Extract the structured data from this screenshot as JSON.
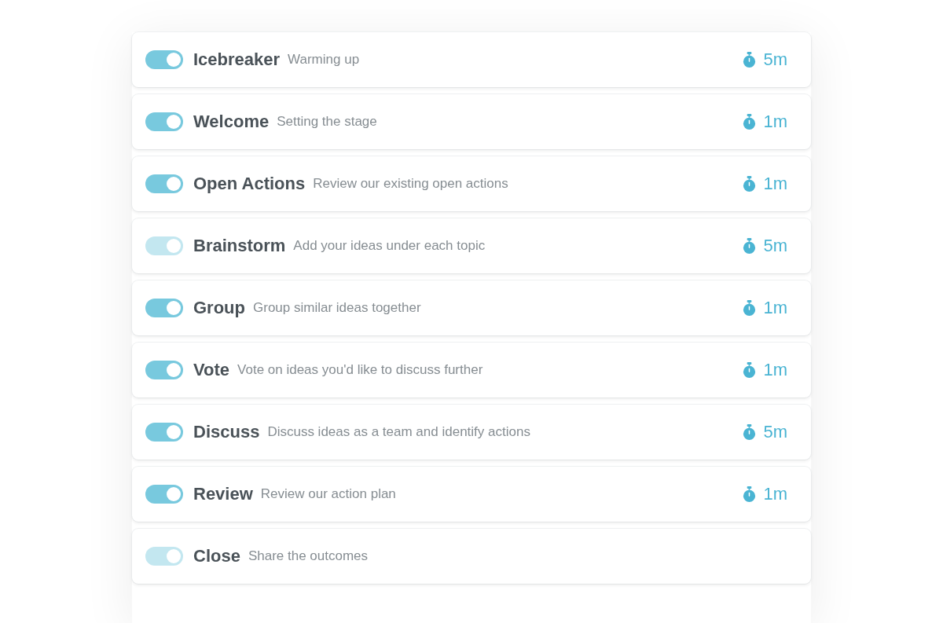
{
  "steps": [
    {
      "title": "Icebreaker",
      "description": "Warming up",
      "on": true,
      "disabled": false,
      "duration": "5m"
    },
    {
      "title": "Welcome",
      "description": "Setting the stage",
      "on": true,
      "disabled": false,
      "duration": "1m"
    },
    {
      "title": "Open Actions",
      "description": "Review our existing open actions",
      "on": true,
      "disabled": false,
      "duration": "1m"
    },
    {
      "title": "Brainstorm",
      "description": "Add your ideas under each topic",
      "on": true,
      "disabled": true,
      "duration": "5m"
    },
    {
      "title": "Group",
      "description": "Group similar ideas together",
      "on": true,
      "disabled": false,
      "duration": "1m"
    },
    {
      "title": "Vote",
      "description": "Vote on ideas you'd like to discuss further",
      "on": true,
      "disabled": false,
      "duration": "1m"
    },
    {
      "title": "Discuss",
      "description": "Discuss ideas as a team and identify actions",
      "on": true,
      "disabled": false,
      "duration": "5m"
    },
    {
      "title": "Review",
      "description": "Review our action plan",
      "on": true,
      "disabled": false,
      "duration": "1m"
    },
    {
      "title": "Close",
      "description": "Share the outcomes",
      "on": true,
      "disabled": true
    }
  ]
}
